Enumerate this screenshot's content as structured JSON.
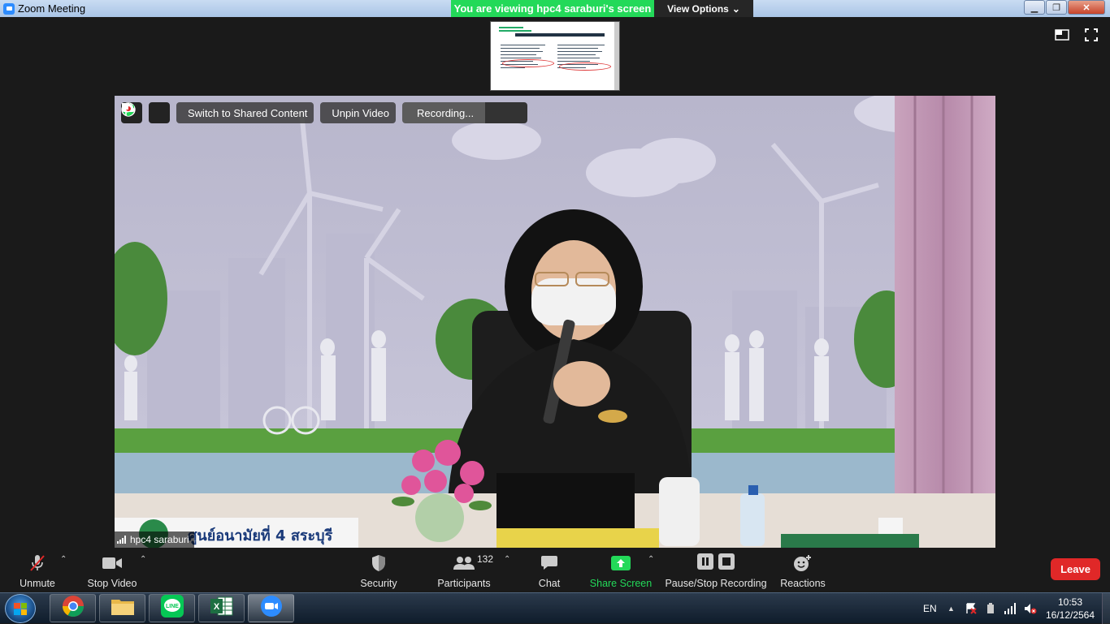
{
  "window": {
    "title": "Zoom Meeting",
    "banner": "You are viewing hpc4 saraburi's screen",
    "view_options": "View Options"
  },
  "video_toolbar": {
    "switch_label": "Switch to Shared Content",
    "unpin_label": "Unpin Video",
    "recording_label": "Recording..."
  },
  "video": {
    "participant_name": "hpc4 saraburi",
    "banner_text": "ศูนย์อนามัยที่ 4 สระบุรี"
  },
  "controls": {
    "unmute": "Unmute",
    "stop_video": "Stop Video",
    "security": "Security",
    "participants": "Participants",
    "participants_count": "132",
    "chat": "Chat",
    "share_screen": "Share Screen",
    "recording": "Pause/Stop Recording",
    "reactions": "Reactions",
    "leave": "Leave"
  },
  "taskbar": {
    "apps": [
      "chrome-icon",
      "file-explorer-icon",
      "line-icon",
      "excel-icon",
      "zoom-icon"
    ],
    "language": "EN",
    "time": "10:53",
    "date": "16/12/2564"
  },
  "colors": {
    "banner_green": "#23d959",
    "share_green": "#23d959",
    "leave_red": "#e02828",
    "zoom_blue": "#2d8cff"
  }
}
